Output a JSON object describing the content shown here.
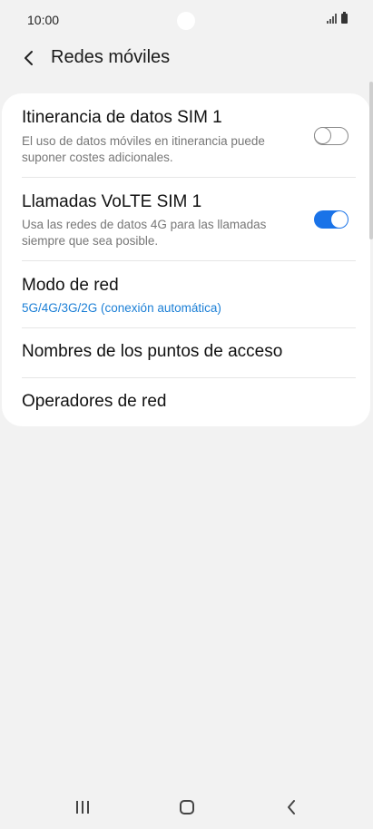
{
  "status": {
    "time": "10:00"
  },
  "header": {
    "title": "Redes móviles"
  },
  "settings": {
    "roaming": {
      "title": "Itinerancia de datos SIM 1",
      "subtitle": "El uso de datos móviles en itinerancia puede suponer costes adicionales.",
      "enabled": false
    },
    "volte": {
      "title": "Llamadas VoLTE SIM 1",
      "subtitle": "Usa las redes de datos 4G para las llamadas siempre que sea posible.",
      "enabled": true
    },
    "network_mode": {
      "title": "Modo de red",
      "value": "5G/4G/3G/2G (conexión automática)"
    },
    "apn": {
      "title": "Nombres de los puntos de acceso"
    },
    "operators": {
      "title": "Operadores de red"
    }
  },
  "colors": {
    "accent": "#1a73e8",
    "link": "#1b7fd6",
    "background": "#f2f2f2"
  },
  "icons": {
    "back": "chevron-left-icon",
    "recents": "recents-icon",
    "home": "home-icon",
    "nav_back": "nav-back-icon"
  }
}
